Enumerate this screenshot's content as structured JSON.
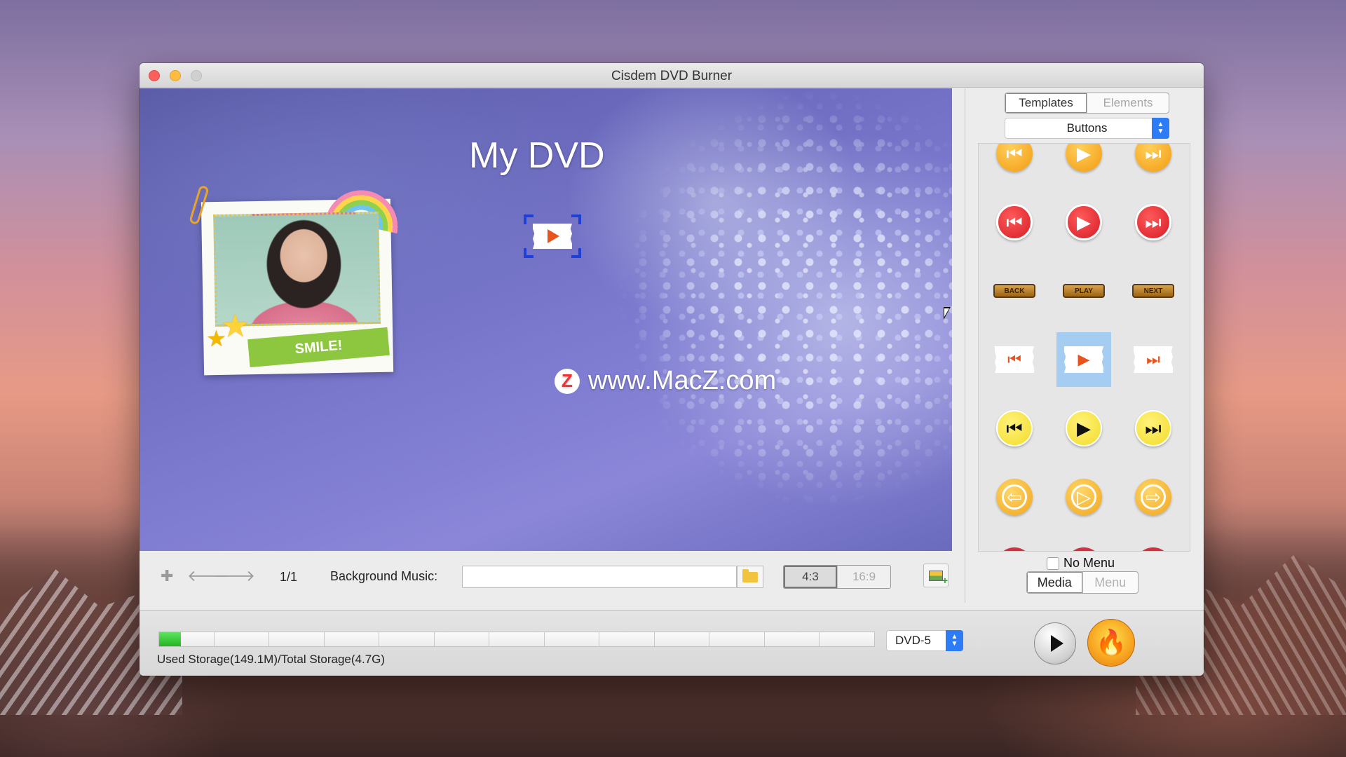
{
  "window": {
    "title": "Cisdem DVD Burner"
  },
  "canvas": {
    "menu_title": "My DVD",
    "sticker_text": "SMILE!",
    "watermark_text": "www.MacZ.com",
    "watermark_logo": "Z"
  },
  "canvas_bar": {
    "add_icon": "plus-icon",
    "prev_icon": "arrow-left-icon",
    "next_icon": "arrow-right-icon",
    "page": "1/1",
    "bg_music_label": "Background Music:",
    "bg_music_value": "",
    "ratio_options": [
      "4:3",
      "16:9"
    ],
    "ratio_selected": "4:3"
  },
  "sidebar": {
    "tabs": [
      "Templates",
      "Elements"
    ],
    "active_tab": "Templates",
    "category": "Buttons",
    "grid_selected": "ticket-play",
    "no_menu_label": "No Menu",
    "no_menu_checked": false,
    "mode_tabs": [
      "Media",
      "Menu"
    ],
    "active_mode": "Media",
    "pill_labels": [
      "BACK",
      "PLAY",
      "NEXT"
    ]
  },
  "bottom": {
    "storage_text": "Used Storage(149.1M)/Total Storage(4.7G)",
    "used_fraction": 0.03,
    "disc_type": "DVD-5",
    "play_icon": "play-icon",
    "burn_icon": "flame-icon"
  }
}
